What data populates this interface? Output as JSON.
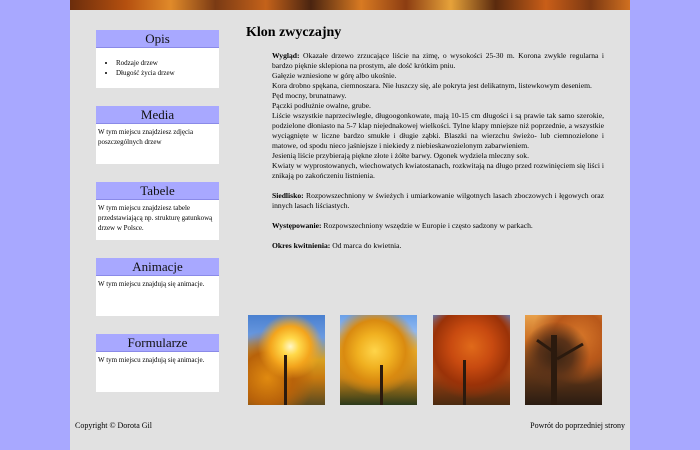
{
  "sidebar": {
    "boxes": [
      {
        "title": "Opis",
        "items": [
          "Rodzaje drzew",
          "Długość życia drzew"
        ]
      },
      {
        "title": "Media",
        "text": "W tym miejscu znajdziesz zdjęcia poszczególnych drzew"
      },
      {
        "title": "Tabele",
        "text": "W tym miejscu znajdziesz tabele przedstawiającą np. strukturę gatunkową drzew w Polsce."
      },
      {
        "title": "Animacje",
        "text": "W tym miejscu znajdują się animacje."
      },
      {
        "title": "Formularze",
        "text": "W tym miejscu znajdują się animacje."
      }
    ]
  },
  "main": {
    "title": "Klon zwyczajny",
    "wyglad_label": "Wygląd:",
    "wyglad_lines": [
      "Okazałe drzewo zrzucające liście na zimę, o wysokości 25-30 m. Korona zwykle regularna i bardzo pięknie sklepiona na prostym, ale dość krótkim pniu.",
      "Gałęzie wzniesione w górę albo ukośnie.",
      "Kora drobno spękana, ciemnoszara. Nie łuszczy się, ale pokryta jest delikatnym, listewkowym deseniem.",
      "Pęd mocny, brunatnawy.",
      "Pączki podłużnie owalne, grube.",
      "Liście wszystkie naprzeciwległe, długoogonkowate, mają 10-15 cm długości i są prawie tak samo szerokie, podzielone dłoniasto na 5-7 klap niejednakowej wielkości. Tylne klapy mniejsze niż poprzednie, a wszystkie wyciągnięte w liczne bardzo smukłe i długie ząbki. Blaszki na wierzchu świeżo- lub ciemnozielone i matowe, od spodu nieco jaśniejsze i niekiedy z niebieskawozielonym zabarwieniem.",
      "Jesienią liście przybierają piękne złote i żółte barwy. Ogonek wydziela mleczny sok.",
      "Kwiaty w wyprostowanych, wiechowatych kwiatostanach, rozkwitają na długo przed rozwinięciem się liści i znikają po zakończeniu listnienia."
    ],
    "siedlisko_label": "Siedlisko:",
    "siedlisko_text": "Rozpowszechniony w świeżych i umiarkowanie wilgotnych lasach zboczowych i łęgowych oraz innych lasach liściastych.",
    "wystepowanie_label": "Występowanie:",
    "wystepowanie_text": "Rozpowszechniony wszędzie w Europie i często sadzony w parkach.",
    "kwitnienie_label": "Okres kwitnienia:",
    "kwitnienie_text": "Od marca do kwietnia."
  },
  "footer": {
    "copyright": "Copyright © Dorota Gil",
    "back_link": "Powrót do poprzedniej strony"
  }
}
